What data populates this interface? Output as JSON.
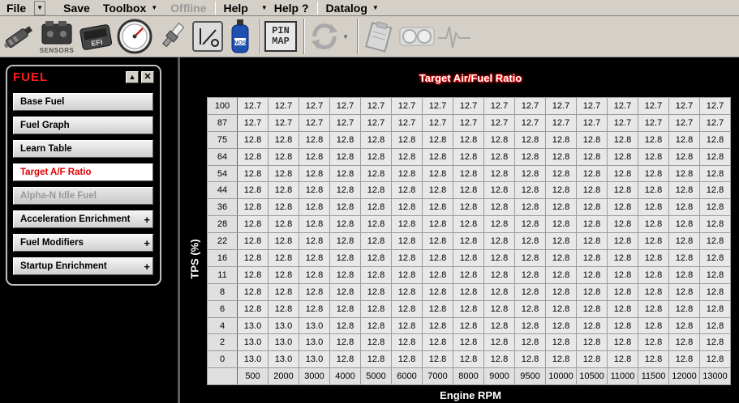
{
  "menu": {
    "file": "File",
    "save": "Save",
    "toolbox": "Toolbox",
    "offline": "Offline",
    "help": "Help",
    "help_q": "Help ?",
    "datalog": "Datalog"
  },
  "toolbar": {
    "sensors_label": "SENSORS",
    "pin_map_top": "PIN",
    "pin_map_bottom": "MAP",
    "nos_label": "NOS"
  },
  "panel": {
    "title": "FUEL",
    "minimize": "▲",
    "close": "✕",
    "items": [
      {
        "label": "Base Fuel",
        "state": "normal",
        "expand": ""
      },
      {
        "label": "Fuel Graph",
        "state": "normal",
        "expand": ""
      },
      {
        "label": "Learn Table",
        "state": "normal",
        "expand": ""
      },
      {
        "label": "Target A/F Ratio",
        "state": "active",
        "expand": ""
      },
      {
        "label": "Alpha-N Idle Fuel",
        "state": "disabled",
        "expand": ""
      },
      {
        "label": "Acceleration Enrichment",
        "state": "normal",
        "expand": "+"
      },
      {
        "label": "Fuel Modifiers",
        "state": "normal",
        "expand": "+"
      },
      {
        "label": "Startup Enrichment",
        "state": "normal",
        "expand": "+"
      }
    ]
  },
  "table": {
    "title": "Target Air/Fuel Ratio",
    "y_axis_label": "TPS (%)",
    "x_axis_label": "Engine RPM",
    "rpm": [
      "500",
      "2000",
      "3000",
      "4000",
      "5000",
      "6000",
      "7000",
      "8000",
      "9000",
      "9500",
      "10000",
      "10500",
      "11000",
      "11500",
      "12000",
      "13000"
    ],
    "rows": [
      {
        "tps": "100",
        "values": [
          "12.7",
          "12.7",
          "12.7",
          "12.7",
          "12.7",
          "12.7",
          "12.7",
          "12.7",
          "12.7",
          "12.7",
          "12.7",
          "12.7",
          "12.7",
          "12.7",
          "12.7",
          "12.7"
        ]
      },
      {
        "tps": "87",
        "values": [
          "12.7",
          "12.7",
          "12.7",
          "12.7",
          "12.7",
          "12.7",
          "12.7",
          "12.7",
          "12.7",
          "12.7",
          "12.7",
          "12.7",
          "12.7",
          "12.7",
          "12.7",
          "12.7"
        ]
      },
      {
        "tps": "75",
        "values": [
          "12.8",
          "12.8",
          "12.8",
          "12.8",
          "12.8",
          "12.8",
          "12.8",
          "12.8",
          "12.8",
          "12.8",
          "12.8",
          "12.8",
          "12.8",
          "12.8",
          "12.8",
          "12.8"
        ]
      },
      {
        "tps": "64",
        "values": [
          "12.8",
          "12.8",
          "12.8",
          "12.8",
          "12.8",
          "12.8",
          "12.8",
          "12.8",
          "12.8",
          "12.8",
          "12.8",
          "12.8",
          "12.8",
          "12.8",
          "12.8",
          "12.8"
        ]
      },
      {
        "tps": "54",
        "values": [
          "12.8",
          "12.8",
          "12.8",
          "12.8",
          "12.8",
          "12.8",
          "12.8",
          "12.8",
          "12.8",
          "12.8",
          "12.8",
          "12.8",
          "12.8",
          "12.8",
          "12.8",
          "12.8"
        ]
      },
      {
        "tps": "44",
        "values": [
          "12.8",
          "12.8",
          "12.8",
          "12.8",
          "12.8",
          "12.8",
          "12.8",
          "12.8",
          "12.8",
          "12.8",
          "12.8",
          "12.8",
          "12.8",
          "12.8",
          "12.8",
          "12.8"
        ]
      },
      {
        "tps": "36",
        "values": [
          "12.8",
          "12.8",
          "12.8",
          "12.8",
          "12.8",
          "12.8",
          "12.8",
          "12.8",
          "12.8",
          "12.8",
          "12.8",
          "12.8",
          "12.8",
          "12.8",
          "12.8",
          "12.8"
        ]
      },
      {
        "tps": "28",
        "values": [
          "12.8",
          "12.8",
          "12.8",
          "12.8",
          "12.8",
          "12.8",
          "12.8",
          "12.8",
          "12.8",
          "12.8",
          "12.8",
          "12.8",
          "12.8",
          "12.8",
          "12.8",
          "12.8"
        ]
      },
      {
        "tps": "22",
        "values": [
          "12.8",
          "12.8",
          "12.8",
          "12.8",
          "12.8",
          "12.8",
          "12.8",
          "12.8",
          "12.8",
          "12.8",
          "12.8",
          "12.8",
          "12.8",
          "12.8",
          "12.8",
          "12.8"
        ]
      },
      {
        "tps": "16",
        "values": [
          "12.8",
          "12.8",
          "12.8",
          "12.8",
          "12.8",
          "12.8",
          "12.8",
          "12.8",
          "12.8",
          "12.8",
          "12.8",
          "12.8",
          "12.8",
          "12.8",
          "12.8",
          "12.8"
        ]
      },
      {
        "tps": "11",
        "values": [
          "12.8",
          "12.8",
          "12.8",
          "12.8",
          "12.8",
          "12.8",
          "12.8",
          "12.8",
          "12.8",
          "12.8",
          "12.8",
          "12.8",
          "12.8",
          "12.8",
          "12.8",
          "12.8"
        ]
      },
      {
        "tps": "8",
        "values": [
          "12.8",
          "12.8",
          "12.8",
          "12.8",
          "12.8",
          "12.8",
          "12.8",
          "12.8",
          "12.8",
          "12.8",
          "12.8",
          "12.8",
          "12.8",
          "12.8",
          "12.8",
          "12.8"
        ]
      },
      {
        "tps": "6",
        "values": [
          "12.8",
          "12.8",
          "12.8",
          "12.8",
          "12.8",
          "12.8",
          "12.8",
          "12.8",
          "12.8",
          "12.8",
          "12.8",
          "12.8",
          "12.8",
          "12.8",
          "12.8",
          "12.8"
        ]
      },
      {
        "tps": "4",
        "values": [
          "13.0",
          "13.0",
          "13.0",
          "12.8",
          "12.8",
          "12.8",
          "12.8",
          "12.8",
          "12.8",
          "12.8",
          "12.8",
          "12.8",
          "12.8",
          "12.8",
          "12.8",
          "12.8"
        ]
      },
      {
        "tps": "2",
        "values": [
          "13.0",
          "13.0",
          "13.0",
          "12.8",
          "12.8",
          "12.8",
          "12.8",
          "12.8",
          "12.8",
          "12.8",
          "12.8",
          "12.8",
          "12.8",
          "12.8",
          "12.8",
          "12.8"
        ]
      },
      {
        "tps": "0",
        "values": [
          "13.0",
          "13.0",
          "13.0",
          "12.8",
          "12.8",
          "12.8",
          "12.8",
          "12.8",
          "12.8",
          "12.8",
          "12.8",
          "12.8",
          "12.8",
          "12.8",
          "12.8",
          "12.8"
        ]
      }
    ]
  }
}
